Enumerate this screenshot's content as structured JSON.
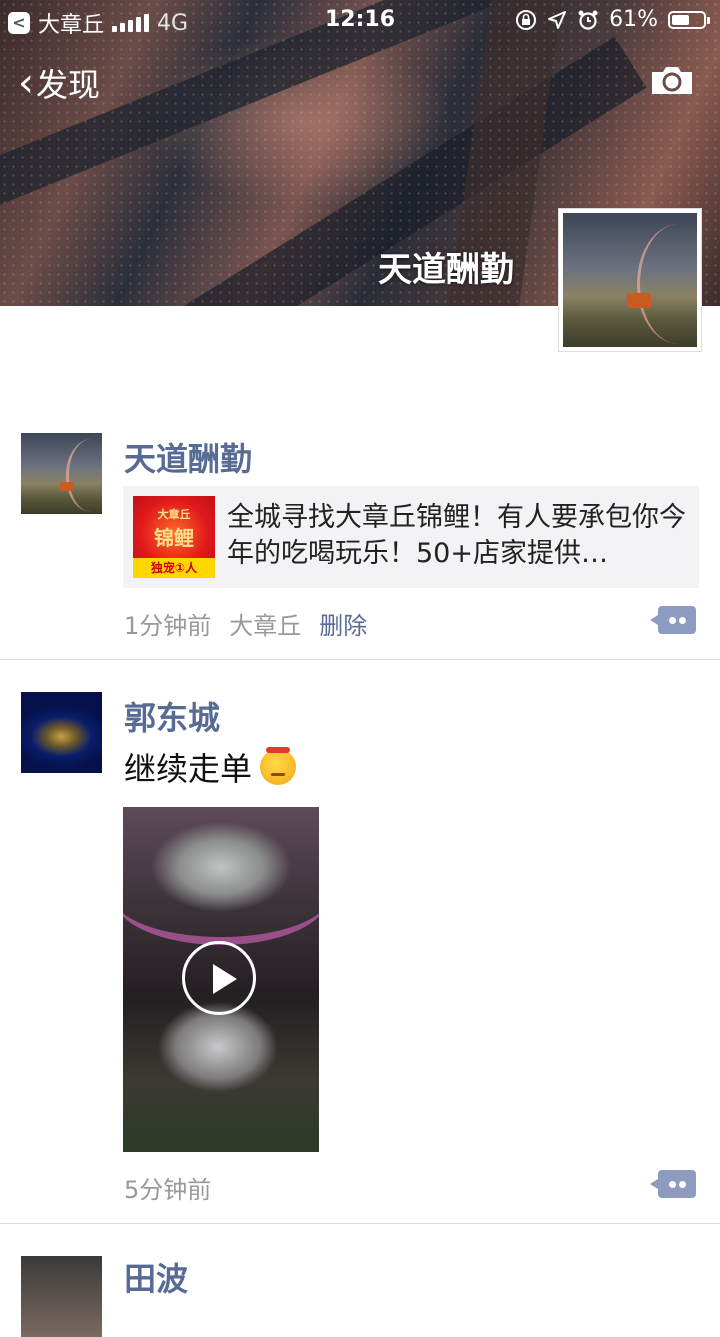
{
  "statusbar": {
    "back_app": "大章丘",
    "carrier": "4G",
    "time": "12:16",
    "battery": "61%",
    "battery_level": 0.61
  },
  "nav": {
    "back_label": "发现",
    "camera_icon": "camera-icon"
  },
  "profile": {
    "name": "天道酬勤"
  },
  "posts": [
    {
      "author": "天道酬勤",
      "link": {
        "thumb_top": "大章丘",
        "thumb_main": "锦鲤",
        "thumb_band": "独宠①人",
        "title": "全城寻找大章丘锦鲤！有人要承包你今年的吃喝玩乐！50+店家提供…"
      },
      "time": "1分钟前",
      "location": "大章丘",
      "delete_label": "删除"
    },
    {
      "author": "郭东城",
      "text": "继续走单",
      "time": "5分钟前"
    },
    {
      "author": "田波"
    }
  ],
  "colors": {
    "link_blue": "#576b95",
    "comment_button": "#8c9bbf",
    "card_bg": "#f3f3f5"
  }
}
